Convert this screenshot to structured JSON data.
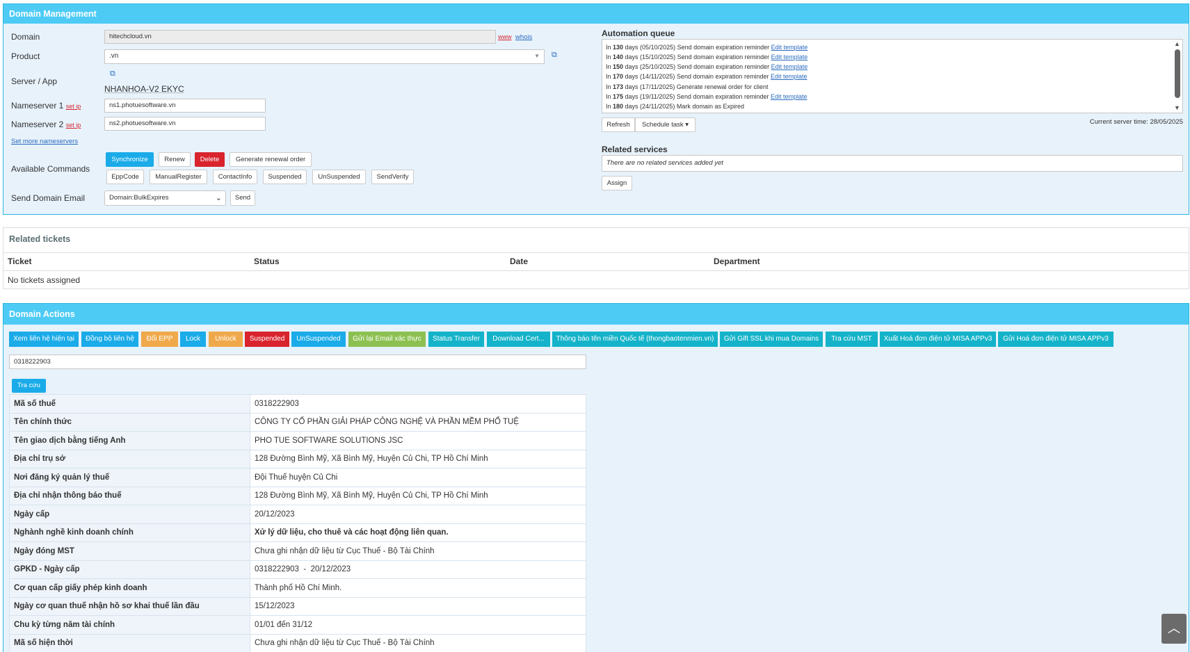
{
  "domain_mgmt": {
    "title": "Domain Management",
    "domain_label": "Domain",
    "domain_value": "hitechcloud.vn",
    "www_link": "www",
    "whois_link": "whois",
    "product_label": "Product",
    "product_value": ".vn",
    "server_label": "Server / App",
    "server_value": "NHANHOA-V2 EKYC",
    "ns1_label": "Nameserver 1",
    "ns1_value": "ns1.photuesoftware.vn",
    "ns2_label": "Nameserver 2",
    "ns2_value": "ns2.photuesoftware.vn",
    "set_ip": "set ip",
    "set_more": "Set more nameservers",
    "commands_label": "Available Commands",
    "commands_row1": [
      "Synchronize",
      "Renew",
      "Delete",
      "Generate renewal order"
    ],
    "commands_row2": [
      "EppCode",
      "ManualRegister",
      "ContactInfo",
      "Suspended",
      "UnSuspended",
      "SendVerify"
    ],
    "send_email_label": "Send Domain Email",
    "send_email_value": "Domain:BulkExpires",
    "send_button": "Send"
  },
  "automation": {
    "title": "Automation queue",
    "items": [
      {
        "pre": "In ",
        "days": "130",
        "post": " days (05/10/2025) Send domain expiration reminder ",
        "link": "Edit template"
      },
      {
        "pre": "In ",
        "days": "140",
        "post": " days (15/10/2025) Send domain expiration reminder ",
        "link": "Edit template"
      },
      {
        "pre": "In ",
        "days": "150",
        "post": " days (25/10/2025) Send domain expiration reminder ",
        "link": "Edit template"
      },
      {
        "pre": "In ",
        "days": "170",
        "post": " days (14/11/2025) Send domain expiration reminder ",
        "link": "Edit template"
      },
      {
        "pre": "In ",
        "days": "173",
        "post": " days (17/11/2025) Generate renewal order for client",
        "link": ""
      },
      {
        "pre": "In ",
        "days": "175",
        "post": " days (19/11/2025) Send domain expiration reminder ",
        "link": "Edit template"
      },
      {
        "pre": "In ",
        "days": "180",
        "post": " days (24/11/2025) Mark domain as Expired",
        "link": ""
      }
    ],
    "refresh": "Refresh",
    "schedule": "Schedule task ▾",
    "server_time": "Current server time: 28/05/2025"
  },
  "related_services": {
    "title": "Related services",
    "empty": "There are no related services added yet",
    "assign": "Assign"
  },
  "tickets": {
    "title": "Related tickets",
    "headers": [
      "Ticket",
      "Status",
      "Date",
      "Department"
    ],
    "empty": "No tickets assigned"
  },
  "actions": {
    "title": "Domain Actions",
    "buttons": [
      "Xem liên hệ hiện tại",
      "Đồng bộ liên hệ",
      "Đổi EPP",
      "Lock",
      "Unlock",
      "Suspended",
      "UnSuspended",
      "Gửi lại Email xác thực",
      "Status Transfer",
      "Download Cert...",
      "Thông báo tên miền Quốc tế (thongbaotenmien.vn)",
      "Gửi Gift SSL khi mua Domains",
      "Tra cứu MST",
      "Xuất Hoá đơn điện tử MISA APPv3",
      "Gửi Hoá đơn điện tử MISA APPv3"
    ],
    "colors": {
      "cyan": "#1aabe8",
      "orange": "#f0a94a",
      "red": "#d9232d",
      "green": "#8cc152",
      "teal": "#14b3c9"
    },
    "mst_value": "0318222903",
    "lookup": "Tra cứu",
    "rows": [
      [
        "Mã số thuế",
        "0318222903"
      ],
      [
        "Tên chính thức",
        "CÔNG TY CỔ PHẦN GIẢI PHÁP CÔNG NGHỆ VÀ PHẦN MỀM PHỔ TUỆ"
      ],
      [
        "Tên giao dịch bằng tiếng Anh",
        "PHO TUE SOFTWARE SOLUTIONS JSC"
      ],
      [
        "Địa chỉ trụ sở",
        "128 Đường Bình Mỹ, Xã Bình Mỹ, Huyện Củ Chi, TP Hồ Chí Minh"
      ],
      [
        "Nơi đăng ký quản lý thuế",
        "Đội Thuế huyện Củ Chi"
      ],
      [
        "Địa chỉ nhận thông báo thuế",
        "128 Đường Bình Mỹ, Xã Bình Mỹ, Huyện Củ Chi, TP Hồ Chí Minh"
      ],
      [
        "Ngày cấp",
        "20/12/2023"
      ],
      [
        "Nghành nghề kinh doanh chính",
        "Xử lý dữ liệu, cho thuê và các hoạt động liên quan."
      ],
      [
        "Ngày đóng MST",
        "Chưa ghi nhận dữ liệu từ Cục Thuế - Bộ Tài Chính"
      ],
      [
        "GPKD - Ngày cấp",
        "0318222903  -  20/12/2023"
      ],
      [
        "Cơ quan cấp giấy phép kinh doanh",
        "Thành phố Hồ Chí Minh."
      ],
      [
        "Ngày cơ quan thuế nhận hồ sơ khai thuế lần đầu",
        "15/12/2023"
      ],
      [
        "Chu kỳ từng năm tài chính",
        "01/01 đến 31/12"
      ],
      [
        "Mã số hiện thời",
        "Chưa ghi nhận dữ liệu từ Cục Thuế - Bộ Tài Chính"
      ]
    ]
  },
  "scroll_top_icon": "chevron-up-icon"
}
